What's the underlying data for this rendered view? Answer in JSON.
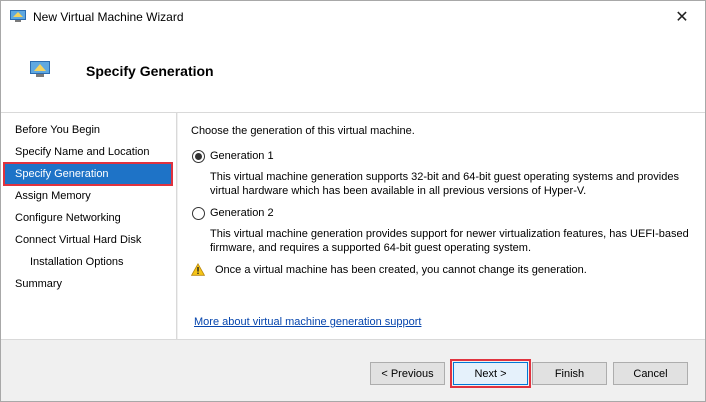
{
  "window": {
    "title": "New Virtual Machine Wizard",
    "close_label": "✕"
  },
  "header": {
    "title": "Specify Generation"
  },
  "nav": {
    "items": [
      {
        "label": "Before You Begin"
      },
      {
        "label": "Specify Name and Location"
      },
      {
        "label": "Specify Generation"
      },
      {
        "label": "Assign Memory"
      },
      {
        "label": "Configure Networking"
      },
      {
        "label": "Connect Virtual Hard Disk"
      },
      {
        "label": "Installation Options"
      },
      {
        "label": "Summary"
      }
    ],
    "selected_index": 2
  },
  "content": {
    "prompt": "Choose the generation of this virtual machine.",
    "options": [
      {
        "label": "Generation 1",
        "checked": true,
        "description": "This virtual machine generation supports 32-bit and 64-bit guest operating systems and provides virtual hardware which has been available in all previous versions of Hyper-V."
      },
      {
        "label": "Generation 2",
        "checked": false,
        "description": "This virtual machine generation provides support for newer virtualization features, has UEFI-based firmware, and requires a supported 64-bit guest operating system."
      }
    ],
    "warning": "Once a virtual machine has been created, you cannot change its generation.",
    "link": "More about virtual machine generation support"
  },
  "footer": {
    "previous_label": "< Previous",
    "next_label": "Next >",
    "finish_label": "Finish",
    "cancel_label": "Cancel"
  },
  "icons": {
    "title": "virtual-machine-icon",
    "header": "virtual-machine-icon",
    "warning": "warning-icon",
    "close": "close-icon"
  },
  "colors": {
    "selection": "#1e73c7",
    "highlight_outline": "#e0333f",
    "link": "#0645ad",
    "warning": "#f5c518"
  }
}
